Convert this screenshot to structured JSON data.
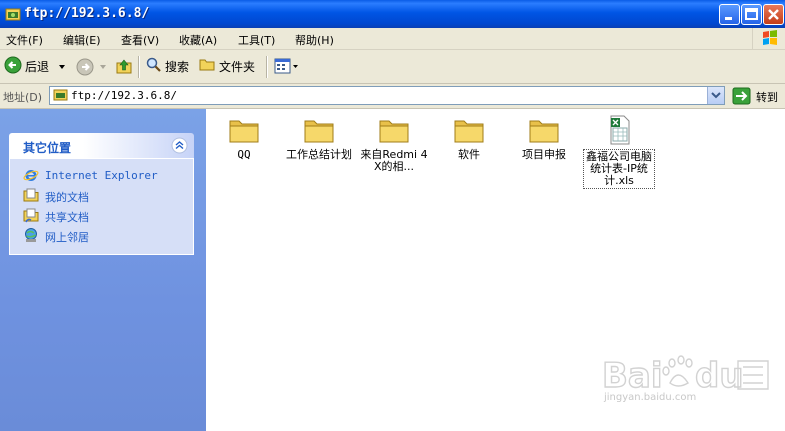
{
  "window": {
    "title": "ftp://192.3.6.8/"
  },
  "menubar": {
    "items": [
      "文件(F)",
      "编辑(E)",
      "查看(V)",
      "收藏(A)",
      "工具(T)",
      "帮助(H)"
    ]
  },
  "toolbar": {
    "back_label": "后退",
    "search_label": "搜索",
    "folders_label": "文件夹"
  },
  "addressbar": {
    "label": "地址(D)",
    "value": "ftp://192.3.6.8/",
    "go_label": "转到"
  },
  "taskpane": {
    "title": "其它位置",
    "links": [
      "Internet Explorer",
      "我的文档",
      "共享文档",
      "网上邻居"
    ]
  },
  "files": [
    {
      "name": "QQ",
      "type": "folder"
    },
    {
      "name": "工作总结计划",
      "type": "folder"
    },
    {
      "name": "来自Redmi 4X的相...",
      "type": "folder"
    },
    {
      "name": "软件",
      "type": "folder"
    },
    {
      "name": "项目申报",
      "type": "folder"
    },
    {
      "name": "鑫福公司电脑统计表-IP统计.xls",
      "type": "excel",
      "selected": true
    }
  ],
  "watermark": {
    "text": "jingyan.baidu.com"
  },
  "colors": {
    "titlebar": "#0055e5",
    "chrome": "#ece9d8",
    "taskpane": "#6f92e0",
    "link": "#215dc6"
  }
}
